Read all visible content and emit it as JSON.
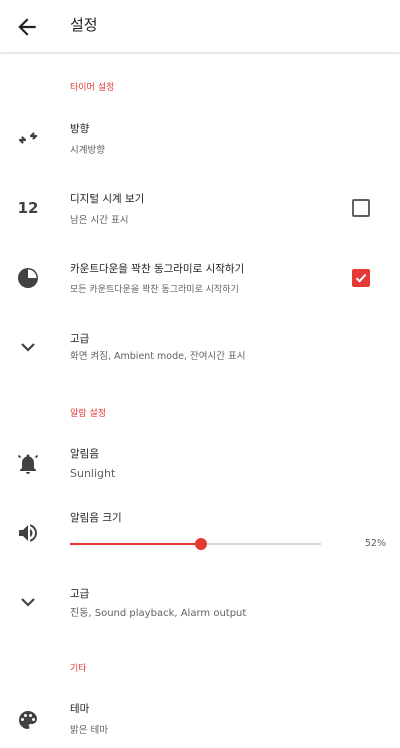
{
  "appbar": {
    "title": "설정",
    "back_icon": "arrow-left-icon"
  },
  "sections": {
    "timer": "타이머 설정",
    "alarm": "알람 설정",
    "other": "기타"
  },
  "timer": {
    "orientation": {
      "icon": "swap-horizontal-icon",
      "title": "방향",
      "subtitle": "시계방향"
    },
    "digital": {
      "icon_text": "12",
      "title": "디지털 시계 보기",
      "subtitle": "남은 시간 표시",
      "checked": false
    },
    "fullcircle": {
      "icon": "pie-circle-icon",
      "title": "카운트다운을 꽉찬 동그라미로 시작하기",
      "subtitle": "모든 카운트다운을 꽉찬 동그라미로 시작하기",
      "checked": true
    },
    "advanced": {
      "icon": "chevron-down-icon",
      "title": "고급",
      "subtitle": "화면 켜짐, Ambient mode, 잔여시간 표시"
    }
  },
  "alarm": {
    "sound": {
      "icon": "bell-ring-icon",
      "title": "알림음",
      "subtitle": "Sunlight"
    },
    "volume": {
      "icon": "speaker-icon",
      "title": "알림음 크기",
      "value_percent": 52,
      "value_label": "52%"
    },
    "advanced": {
      "icon": "chevron-down-icon",
      "title": "고급",
      "subtitle": "진동, Sound playback, Alarm output"
    }
  },
  "other": {
    "theme": {
      "icon": "palette-icon",
      "title": "테마",
      "subtitle": "밝은 테마"
    }
  },
  "colors": {
    "accent": "#e53935",
    "text": "#212121",
    "secondary": "#616161"
  }
}
